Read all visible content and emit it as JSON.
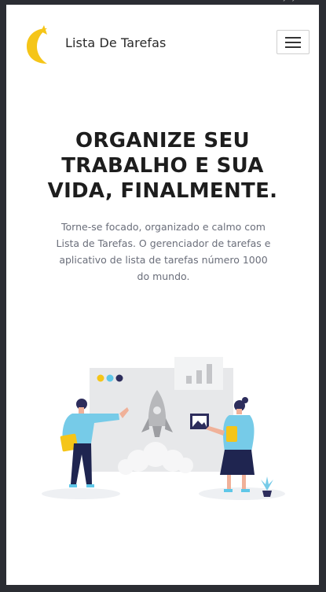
{
  "browser": {
    "top_indicator": "↗ ↗"
  },
  "navbar": {
    "brand": "Lista De Tarefas",
    "logo_icon": "crescent-c-logo-icon",
    "menu_icon": "hamburger-menu-icon"
  },
  "hero": {
    "title_lines": [
      "ORGANIZE SEU",
      "TRABALHO E SUA",
      "VIDA, FINALMENTE."
    ],
    "description": "Torne-se focado, organizado e calmo com Lista de Tarefas. O gerenciador de tarefas e aplicativo de lista de tarefas número 1000 do mundo."
  },
  "illustration": {
    "icons": [
      "rocket-icon",
      "bar-chart-icon",
      "image-frame-icon",
      "plant-icon"
    ],
    "dot_colors": [
      "#f5c518",
      "#5fc7e8",
      "#2d2d5c"
    ]
  },
  "colors": {
    "logo": "#f5c518",
    "shirt": "#76cbe8",
    "pants": "#1f2550",
    "folder": "#f5c518"
  }
}
